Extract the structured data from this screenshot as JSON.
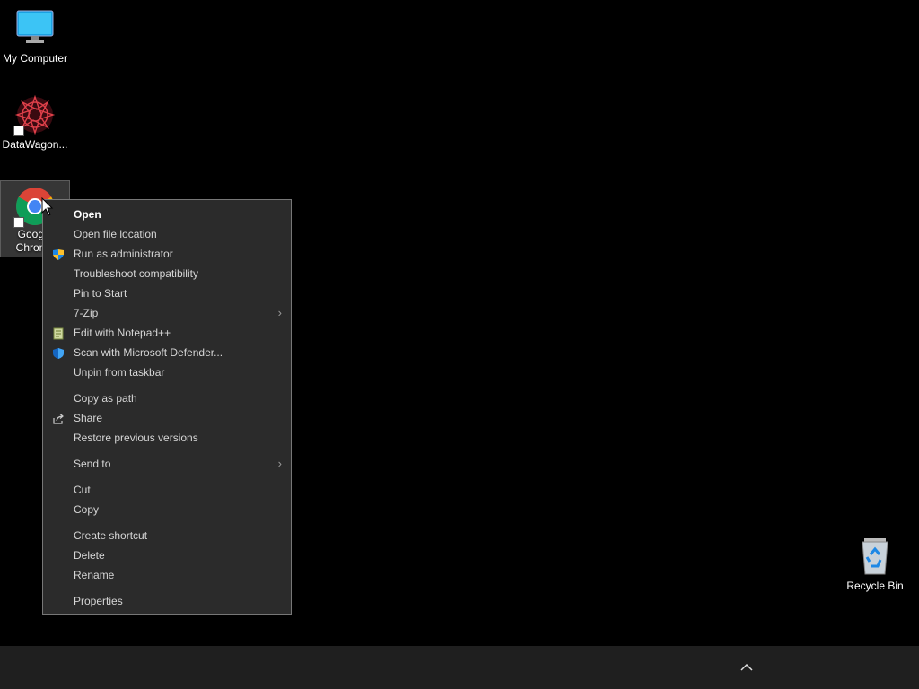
{
  "desktop": {
    "icons": [
      {
        "label": "My Computer",
        "icon": "monitor-icon"
      },
      {
        "label": "DataWagon...",
        "icon": "datawagon-icon"
      },
      {
        "label": "Google Chrome",
        "icon": "chrome-icon"
      },
      {
        "label": "Recycle Bin",
        "icon": "recycle-bin-icon"
      }
    ]
  },
  "context_menu": {
    "items": {
      "open": "Open",
      "open_file_location": "Open file location",
      "run_as_admin": "Run as administrator",
      "troubleshoot": "Troubleshoot compatibility",
      "pin_to_start": "Pin to Start",
      "seven_zip": "7-Zip",
      "edit_notepad": "Edit with Notepad++",
      "scan_defender": "Scan with Microsoft Defender...",
      "unpin_taskbar": "Unpin from taskbar",
      "copy_as_path": "Copy as path",
      "share": "Share",
      "restore_versions": "Restore previous versions",
      "send_to": "Send to",
      "cut": "Cut",
      "copy": "Copy",
      "create_shortcut": "Create shortcut",
      "delete": "Delete",
      "rename": "Rename",
      "properties": "Properties"
    },
    "submenu_arrow": "›"
  },
  "taskbar": {
    "tray_icon": "chevron-up-icon"
  },
  "colors": {
    "desktop_bg": "#000000",
    "menu_bg": "#2b2b2b",
    "menu_border": "#777777",
    "taskbar_bg": "#1f1f1f"
  }
}
